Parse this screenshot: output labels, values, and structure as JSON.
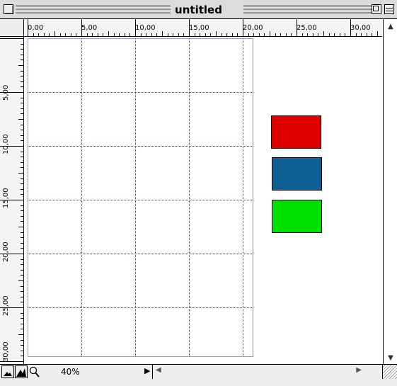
{
  "window": {
    "title": "untitled"
  },
  "ruler": {
    "horizontal_labels": [
      "0,00",
      "5,00",
      "10,00",
      "15,00",
      "20,00",
      "25,00",
      "30,00"
    ],
    "vertical_labels": [
      "5,00",
      "10,00",
      "15,00",
      "20,00",
      "25,00",
      "30,00"
    ]
  },
  "swatches": [
    {
      "name": "red-swatch",
      "color": "#e00000"
    },
    {
      "name": "blue-swatch",
      "color": "#0f6195"
    },
    {
      "name": "green-swatch",
      "color": "#00e000"
    }
  ],
  "statusbar": {
    "zoom": "40%"
  },
  "icons": {
    "mountain_small": "mountain-small-icon",
    "mountain_large": "mountain-large-icon",
    "magnifier": "magnifier-icon"
  },
  "colors": {
    "grid": "#2a2adc",
    "title_bar": "#dcdcdc"
  }
}
